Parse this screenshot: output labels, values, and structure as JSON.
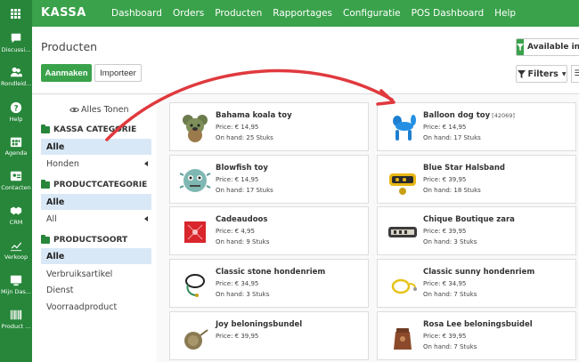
{
  "topbar": {
    "brand": "KASSA",
    "menu": [
      "Dashboard",
      "Orders",
      "Producten",
      "Rapportages",
      "Configuratie",
      "POS Dashboard",
      "Help"
    ]
  },
  "rail": [
    {
      "label": "Discussi...",
      "icon": "chat-icon"
    },
    {
      "label": "Rondleid...",
      "icon": "users-icon"
    },
    {
      "label": "Help",
      "icon": "help-icon"
    },
    {
      "label": "Agenda",
      "icon": "calendar-icon"
    },
    {
      "label": "Contacten",
      "icon": "contacts-icon"
    },
    {
      "label": "CRM",
      "icon": "handshake-icon"
    },
    {
      "label": "Verkoop",
      "icon": "chart-icon"
    },
    {
      "label": "Mijn Das...",
      "icon": "dashboard-icon"
    },
    {
      "label": "Product ...",
      "icon": "barcode-icon"
    }
  ],
  "control": {
    "breadcrumb": "Producten",
    "create_label": "Aanmaken",
    "import_label": "Importeer",
    "facet_label": "Available in P",
    "filters_label": "Filters"
  },
  "sidebar": {
    "show_all": "Alles Tonen",
    "sections": [
      {
        "title": "KASSA CATEGORIE",
        "items": [
          {
            "label": "Alle"
          },
          {
            "label": "Honden"
          }
        ]
      },
      {
        "title": "PRODUCTCATEGORIE",
        "items": [
          {
            "label": "Alle"
          },
          {
            "label": "All"
          }
        ]
      },
      {
        "title": "PRODUCTSOORT",
        "items": [
          {
            "label": "Alle"
          },
          {
            "label": "Verbruiksartikel"
          },
          {
            "label": "Dienst"
          },
          {
            "label": "Voorraadproduct"
          }
        ]
      }
    ]
  },
  "products": [
    {
      "name": "Bahama koala toy",
      "ref": "",
      "price": "Price: € 14,95",
      "onhand": "On hand: 25 Stuks",
      "image": "koala-toy"
    },
    {
      "name": "Balloon dog toy",
      "ref": "[42069]",
      "price": "Price: € 14,95",
      "onhand": "On hand: 17 Stuks",
      "image": "balloon-dog"
    },
    {
      "name": "Blowfish toy",
      "ref": "",
      "price": "Price: € 14,95",
      "onhand": "On hand: 17 Stuks",
      "image": "blowfish-toy"
    },
    {
      "name": "Blue Star Halsband",
      "ref": "",
      "price": "Price: € 39,95",
      "onhand": "On hand: 18 Stuks",
      "image": "collar"
    },
    {
      "name": "Cadeaudoos",
      "ref": "",
      "price": "Price: € 4,95",
      "onhand": "On hand: 9 Stuks",
      "image": "gift-box"
    },
    {
      "name": "Chique Boutique zara",
      "ref": "",
      "price": "Price: € 39,95",
      "onhand": "On hand: 3 Stuks",
      "image": "collar-2"
    },
    {
      "name": "Classic stone hondenriem",
      "ref": "",
      "price": "Price: € 34,95",
      "onhand": "On hand: 3 Stuks",
      "image": "leash"
    },
    {
      "name": "Classic sunny hondenriem",
      "ref": "",
      "price": "Price: € 34,95",
      "onhand": "On hand: 7 Stuks",
      "image": "leash-yellow"
    },
    {
      "name": "Joy beloningsbundel",
      "ref": "",
      "price": "Price: € 39,95",
      "onhand": "",
      "image": "treat-bag"
    },
    {
      "name": "Rosa Lee beloningsbuidel",
      "ref": "",
      "price": "Price: € 39,95",
      "onhand": "On hand: 7 Stuks",
      "image": "treat-pouch"
    }
  ],
  "colors": {
    "brand": "#3aa24b",
    "rail": "#27863a",
    "arrow": "#e0393e",
    "active": "#d9e8f7"
  }
}
